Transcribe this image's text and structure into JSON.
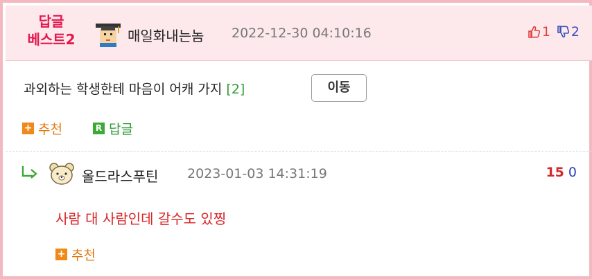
{
  "comment": {
    "badge_line1": "답글",
    "badge_line2": "베스트2",
    "author": "매일화내는놈",
    "timestamp": "2022-12-30 04:10:16",
    "upvotes": "1",
    "downvotes": "2",
    "text": "과외하는 학생한테 마음이 어캐 가지",
    "reply_count": "[2]",
    "move_button": "이동",
    "recommend_label": "추천",
    "reply_label": "답글",
    "reply_icon_letter": "R",
    "plus_symbol": "+"
  },
  "reply": {
    "author": "올드라스푸틴",
    "timestamp": "2023-01-03 14:31:19",
    "upvotes": "15",
    "downvotes": "0",
    "text": "사람 대 사람인데 갈수도 있찡",
    "recommend_label": "추천",
    "plus_symbol": "+"
  },
  "colors": {
    "badge": "#e5174d",
    "header_bg": "#fde9ec",
    "frame_border": "#f3b9c0",
    "up": "#e03c3c",
    "down": "#3a4fb8",
    "recommend": "#e07a10",
    "reply_green": "#2e9b36",
    "reply_text": "#d92424"
  },
  "icons": {
    "avatar1": "graduate-avatar-icon",
    "avatar2": "bear-avatar-icon",
    "thumb_up": "thumbs-up-icon",
    "thumb_down": "thumbs-down-icon",
    "reply_arrow": "reply-arrow-icon"
  }
}
